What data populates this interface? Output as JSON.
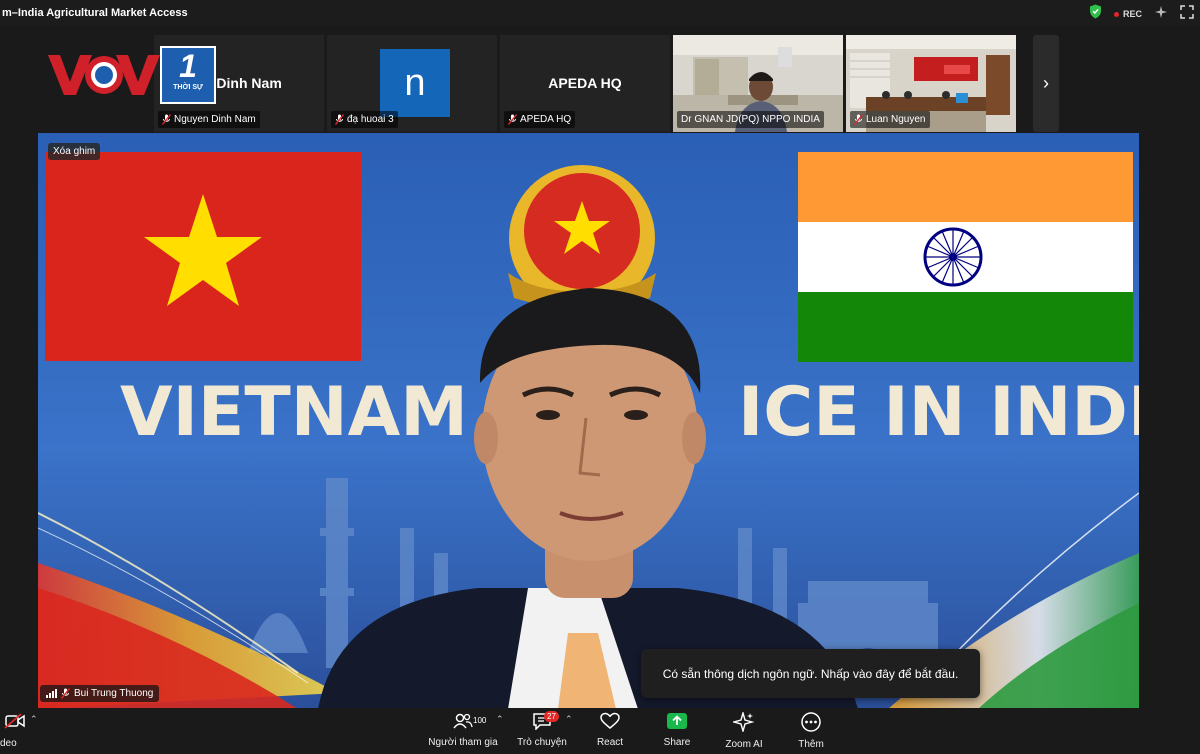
{
  "window": {
    "title": "m–India Agricultural Market Access",
    "rec_label": "REC"
  },
  "thumbnails": [
    {
      "display_name": "en Dinh Nam",
      "label": "Nguyen Dinh Nam",
      "muted": true
    },
    {
      "display_name": "n",
      "label": "đạ huoai 3",
      "muted": true
    },
    {
      "display_name": "APEDA HQ",
      "label": "APEDA HQ",
      "muted": true
    },
    {
      "display_name": "",
      "label": "Dr GNAN JD(PQ) NPPO INDIA",
      "muted": false,
      "active": true
    },
    {
      "display_name": "",
      "label": "Luan Nguyen",
      "muted": true
    }
  ],
  "logo": {
    "vov": "VOV",
    "channel_number": "1",
    "channel_name": "THỜI SỰ"
  },
  "main_video": {
    "pin_label": "Xóa ghim",
    "speaker_name": "Bui Trung Thuong",
    "backdrop_text": "VIETNAM TRA",
    "backdrop_text_2": "ICE IN INDIA"
  },
  "toast": {
    "message": "Có sẵn thông dịch ngôn ngữ. Nhấp vào đây để bắt đầu."
  },
  "toolbar": {
    "video_label": "deo",
    "participants_label": "Người tham gia",
    "participants_count": "100",
    "chat_label": "Trò chuyện",
    "chat_badge": "27",
    "react_label": "React",
    "share_label": "Share",
    "zoom_ai_label": "Zoom AI",
    "more_label": "Thêm"
  },
  "colors": {
    "active_border": "#2fbf4a",
    "share_green": "#18b84a",
    "badge_red": "#e02828",
    "vietnam_red": "#da251d",
    "vietnam_star": "#ffde00",
    "india_saffron": "#ff9933",
    "india_green": "#138808",
    "chakra_blue": "#000080"
  }
}
